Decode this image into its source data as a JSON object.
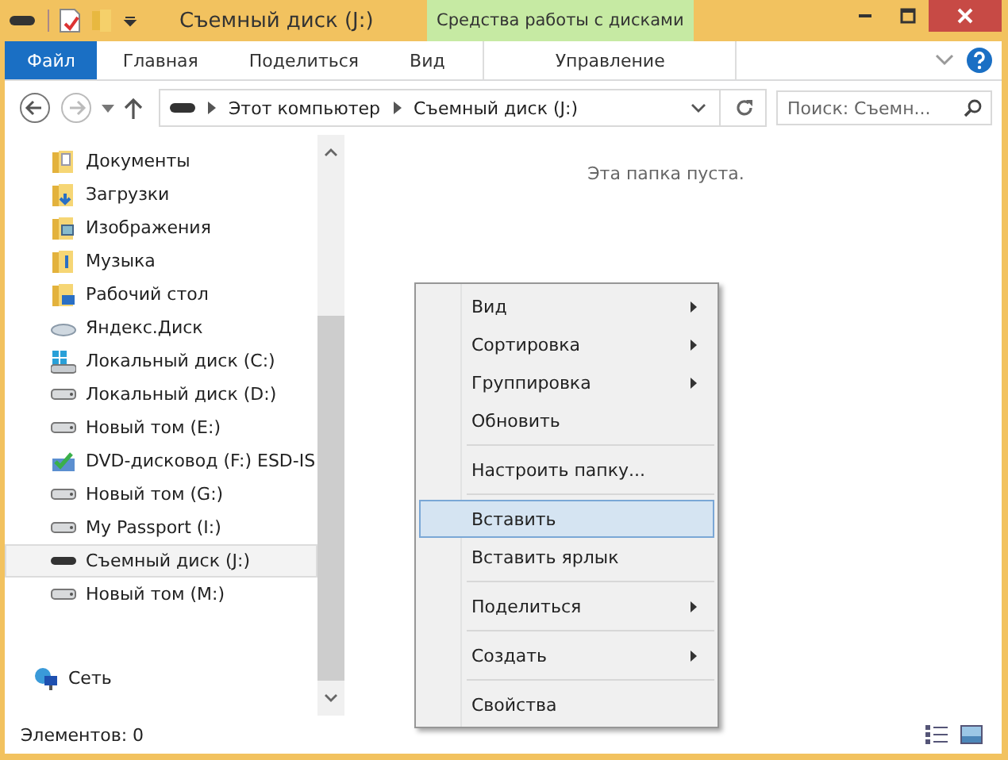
{
  "window": {
    "title": "Съемный диск (J:)",
    "context_tab_group": "Средства работы с дисками"
  },
  "ribbon_tabs": [
    {
      "label": "Файл",
      "kind": "file",
      "selected": false
    },
    {
      "label": "Главная",
      "kind": "tab",
      "selected": false
    },
    {
      "label": "Поделиться",
      "kind": "tab",
      "selected": false
    },
    {
      "label": "Вид",
      "kind": "tab",
      "selected": false
    },
    {
      "label": "Управление",
      "kind": "context",
      "selected": false
    }
  ],
  "address": {
    "path": [
      "Этот компьютер",
      "Съемный диск (J:)"
    ],
    "search_placeholder": "Поиск: Съемн..."
  },
  "sidebar": {
    "items": [
      {
        "label": "Документы",
        "kind": "doc-folder",
        "selected": false
      },
      {
        "label": "Загрузки",
        "kind": "download-folder",
        "selected": false
      },
      {
        "label": "Изображения",
        "kind": "image-folder",
        "selected": false
      },
      {
        "label": "Музыка",
        "kind": "music-folder",
        "selected": false
      },
      {
        "label": "Рабочий стол",
        "kind": "desktop-folder",
        "selected": false
      },
      {
        "label": "Яндекс.Диск",
        "kind": "cloud",
        "selected": false
      },
      {
        "label": "Локальный диск (C:)",
        "kind": "system-drive",
        "selected": false
      },
      {
        "label": "Локальный диск (D:)",
        "kind": "drive",
        "selected": false
      },
      {
        "label": "Новый том (E:)",
        "kind": "drive",
        "selected": false
      },
      {
        "label": "DVD-дисковод (F:) ESD-IS",
        "kind": "dvd",
        "selected": false
      },
      {
        "label": "Новый том (G:)",
        "kind": "drive",
        "selected": false
      },
      {
        "label": "My Passport (I:)",
        "kind": "drive",
        "selected": false
      },
      {
        "label": "Съемный диск (J:)",
        "kind": "removable",
        "selected": true
      },
      {
        "label": "Новый том (M:)",
        "kind": "drive",
        "selected": false
      }
    ],
    "network": {
      "label": "Сеть",
      "kind": "network",
      "selected": false
    }
  },
  "content": {
    "empty_message": "Эта папка пуста."
  },
  "context_menu": {
    "groups": [
      [
        {
          "label": "Вид",
          "submenu": true,
          "selected": false
        },
        {
          "label": "Сортировка",
          "submenu": true,
          "selected": false
        },
        {
          "label": "Группировка",
          "submenu": true,
          "selected": false
        },
        {
          "label": "Обновить",
          "submenu": false,
          "selected": false
        }
      ],
      [
        {
          "label": "Настроить папку...",
          "submenu": false,
          "selected": false
        }
      ],
      [
        {
          "label": "Вставить",
          "submenu": false,
          "selected": true
        },
        {
          "label": "Вставить ярлык",
          "submenu": false,
          "selected": false
        }
      ],
      [
        {
          "label": "Поделиться",
          "submenu": true,
          "selected": false
        }
      ],
      [
        {
          "label": "Создать",
          "submenu": true,
          "selected": false
        }
      ],
      [
        {
          "label": "Свойства",
          "submenu": false,
          "selected": false
        }
      ]
    ]
  },
  "status_bar": {
    "text": "Элементов: 0"
  }
}
